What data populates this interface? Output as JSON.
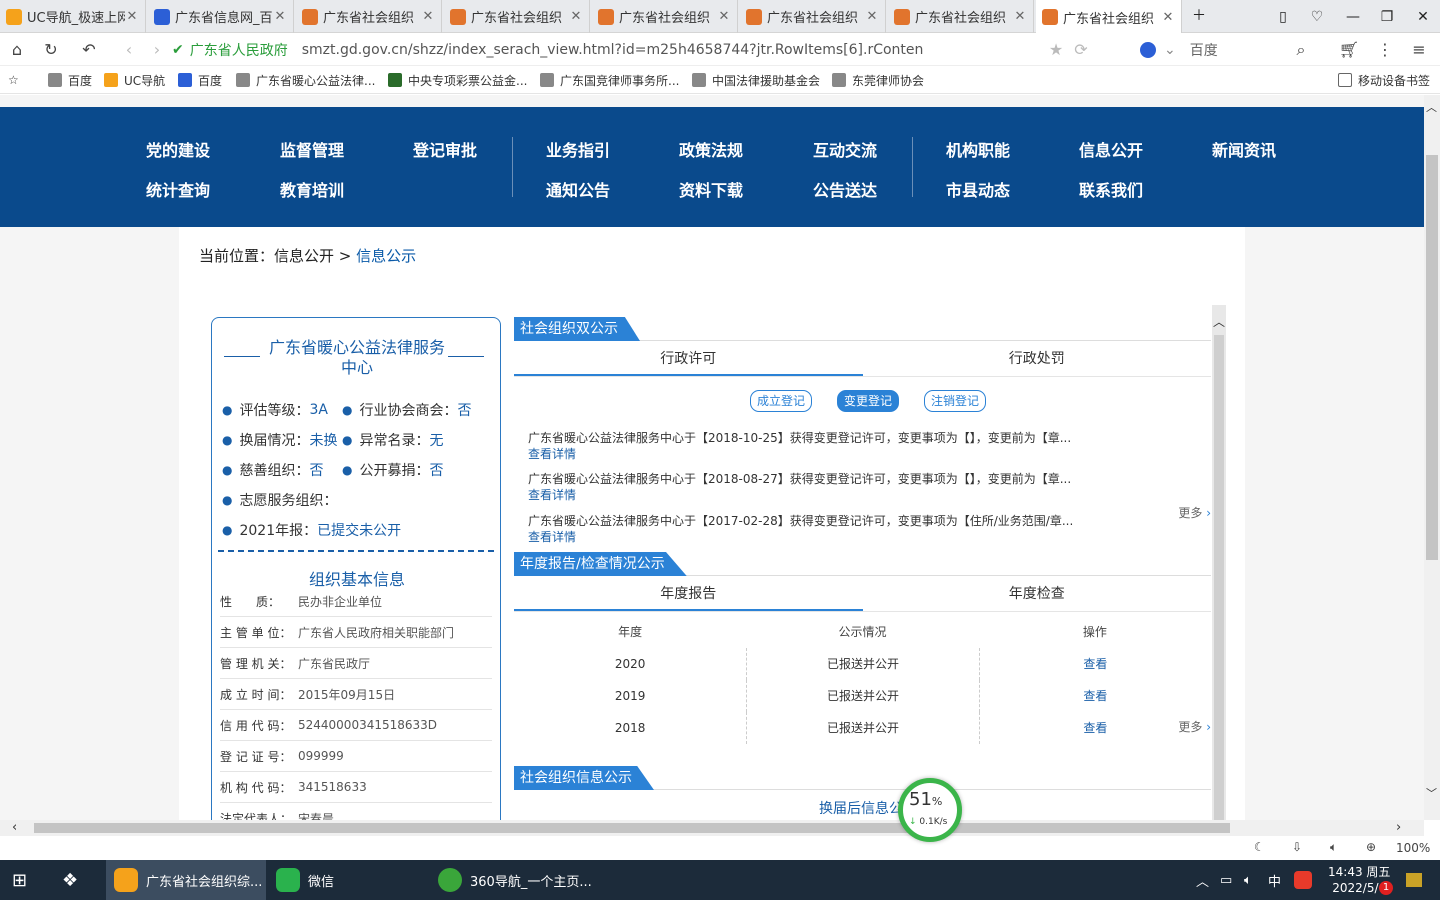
{
  "browser": {
    "tabs": [
      {
        "title": "UC导航_极速上网",
        "color": "#f5a21b"
      },
      {
        "title": "广东省信息网_百",
        "color": "#2c5fd6"
      },
      {
        "title": "广东省社会组织",
        "color": "#e1742d"
      },
      {
        "title": "广东省社会组织",
        "color": "#e1742d"
      },
      {
        "title": "广东省社会组织",
        "color": "#e1742d"
      },
      {
        "title": "广东省社会组织",
        "color": "#e1742d"
      },
      {
        "title": "广东省社会组织",
        "color": "#e1742d"
      },
      {
        "title": "广东省社会组织",
        "color": "#e1742d"
      }
    ],
    "url_site": "广东省人民政府",
    "url_path": "smzt.gd.gov.cn/shzz/index_serach_view.html?id=m25h4658744?jtr.RowItems[6].rConten",
    "search_placeholder": "百度",
    "bookmarks": [
      "百度",
      "UC导航",
      "百度",
      "广东省暖心公益法律...",
      "中央专项彩票公益金...",
      "广东国竞律师事务所...",
      "中国法律援助基金会",
      "东莞律师协会"
    ],
    "mobile_bookmarks": "移动设备书签",
    "zoom": "100%"
  },
  "nav": {
    "row1": [
      "党的建设",
      "监督管理",
      "登记审批",
      "业务指引",
      "政策法规",
      "互动交流",
      "机构职能",
      "信息公开",
      "新闻资讯"
    ],
    "row2": [
      "统计查询",
      "教育培训",
      "",
      "通知公告",
      "资料下载",
      "公告送达",
      "市县动态",
      "联系我们",
      ""
    ]
  },
  "breadcrumb": {
    "prefix": "当前位置：",
    "parent": "信息公开",
    "sep": " > ",
    "current": "信息公示"
  },
  "org": {
    "name": "广东省暖心公益法律服务中心",
    "fields": [
      {
        "k": "评估等级：",
        "v": "3A"
      },
      {
        "k": "行业协会商会：",
        "v": "否"
      },
      {
        "k": "换届情况：",
        "v": "未换"
      },
      {
        "k": "异常名录：",
        "v": "无"
      },
      {
        "k": "慈善组织：",
        "v": "否"
      },
      {
        "k": "公开募捐：",
        "v": "否"
      },
      {
        "k": "志愿服务组织：",
        "v": ""
      },
      {
        "k": "2021年报：",
        "v": "已提交未公开"
      }
    ],
    "basic_title": "组织基本信息",
    "basic": [
      {
        "k": "性　　质：",
        "v": "民办非企业单位"
      },
      {
        "k": "主 管 单 位：",
        "v": "广东省人民政府相关职能部门"
      },
      {
        "k": "管 理 机 关：",
        "v": "广东省民政厅"
      },
      {
        "k": "成 立 时 间：",
        "v": "2015年09月15日"
      },
      {
        "k": "信 用 代 码：",
        "v": "52440000341518633D"
      },
      {
        "k": "登 记 证 号：",
        "v": "099999"
      },
      {
        "k": "机 构 代 码：",
        "v": "341518633"
      },
      {
        "k": "法定代表人：",
        "v": "宋春晨"
      }
    ]
  },
  "sections": {
    "double": {
      "title": "社会组织双公示",
      "tabs": [
        "行政许可",
        "行政处罚"
      ],
      "pills": [
        "成立登记",
        "变更登记",
        "注销登记"
      ],
      "notices": [
        "广东省暖心公益法律服务中心于【2018-10-25】获得变更登记许可，变更事项为【】，变更前为【章...",
        "广东省暖心公益法律服务中心于【2018-08-27】获得变更登记许可，变更事项为【】，变更前为【章...",
        "广东省暖心公益法律服务中心于【2017-02-28】获得变更登记许可，变更事项为【住所/业务范围/章..."
      ],
      "detail": "查看详情",
      "more": "更多"
    },
    "annual": {
      "title": "年度报告/检查情况公示",
      "tabs": [
        "年度报告",
        "年度检查"
      ],
      "headers": [
        "年度",
        "公示情况",
        "操作"
      ],
      "rows": [
        [
          "2020",
          "已报送并公开",
          "查看"
        ],
        [
          "2019",
          "已报送并公开",
          "查看"
        ],
        [
          "2018",
          "已报送并公开",
          "查看"
        ]
      ],
      "more": "更多"
    },
    "info": {
      "title": "社会组织信息公示",
      "sub": "换届后信息公"
    }
  },
  "progress": {
    "percent": "51",
    "unit": "%",
    "speed": "0.1K/s"
  },
  "taskbar": {
    "apps": [
      "广东省社会组织综...",
      "微信",
      "360导航_一个主页..."
    ],
    "time": "14:43 周五",
    "date": "2022/5/6",
    "ime": "中",
    "badge": "1"
  }
}
